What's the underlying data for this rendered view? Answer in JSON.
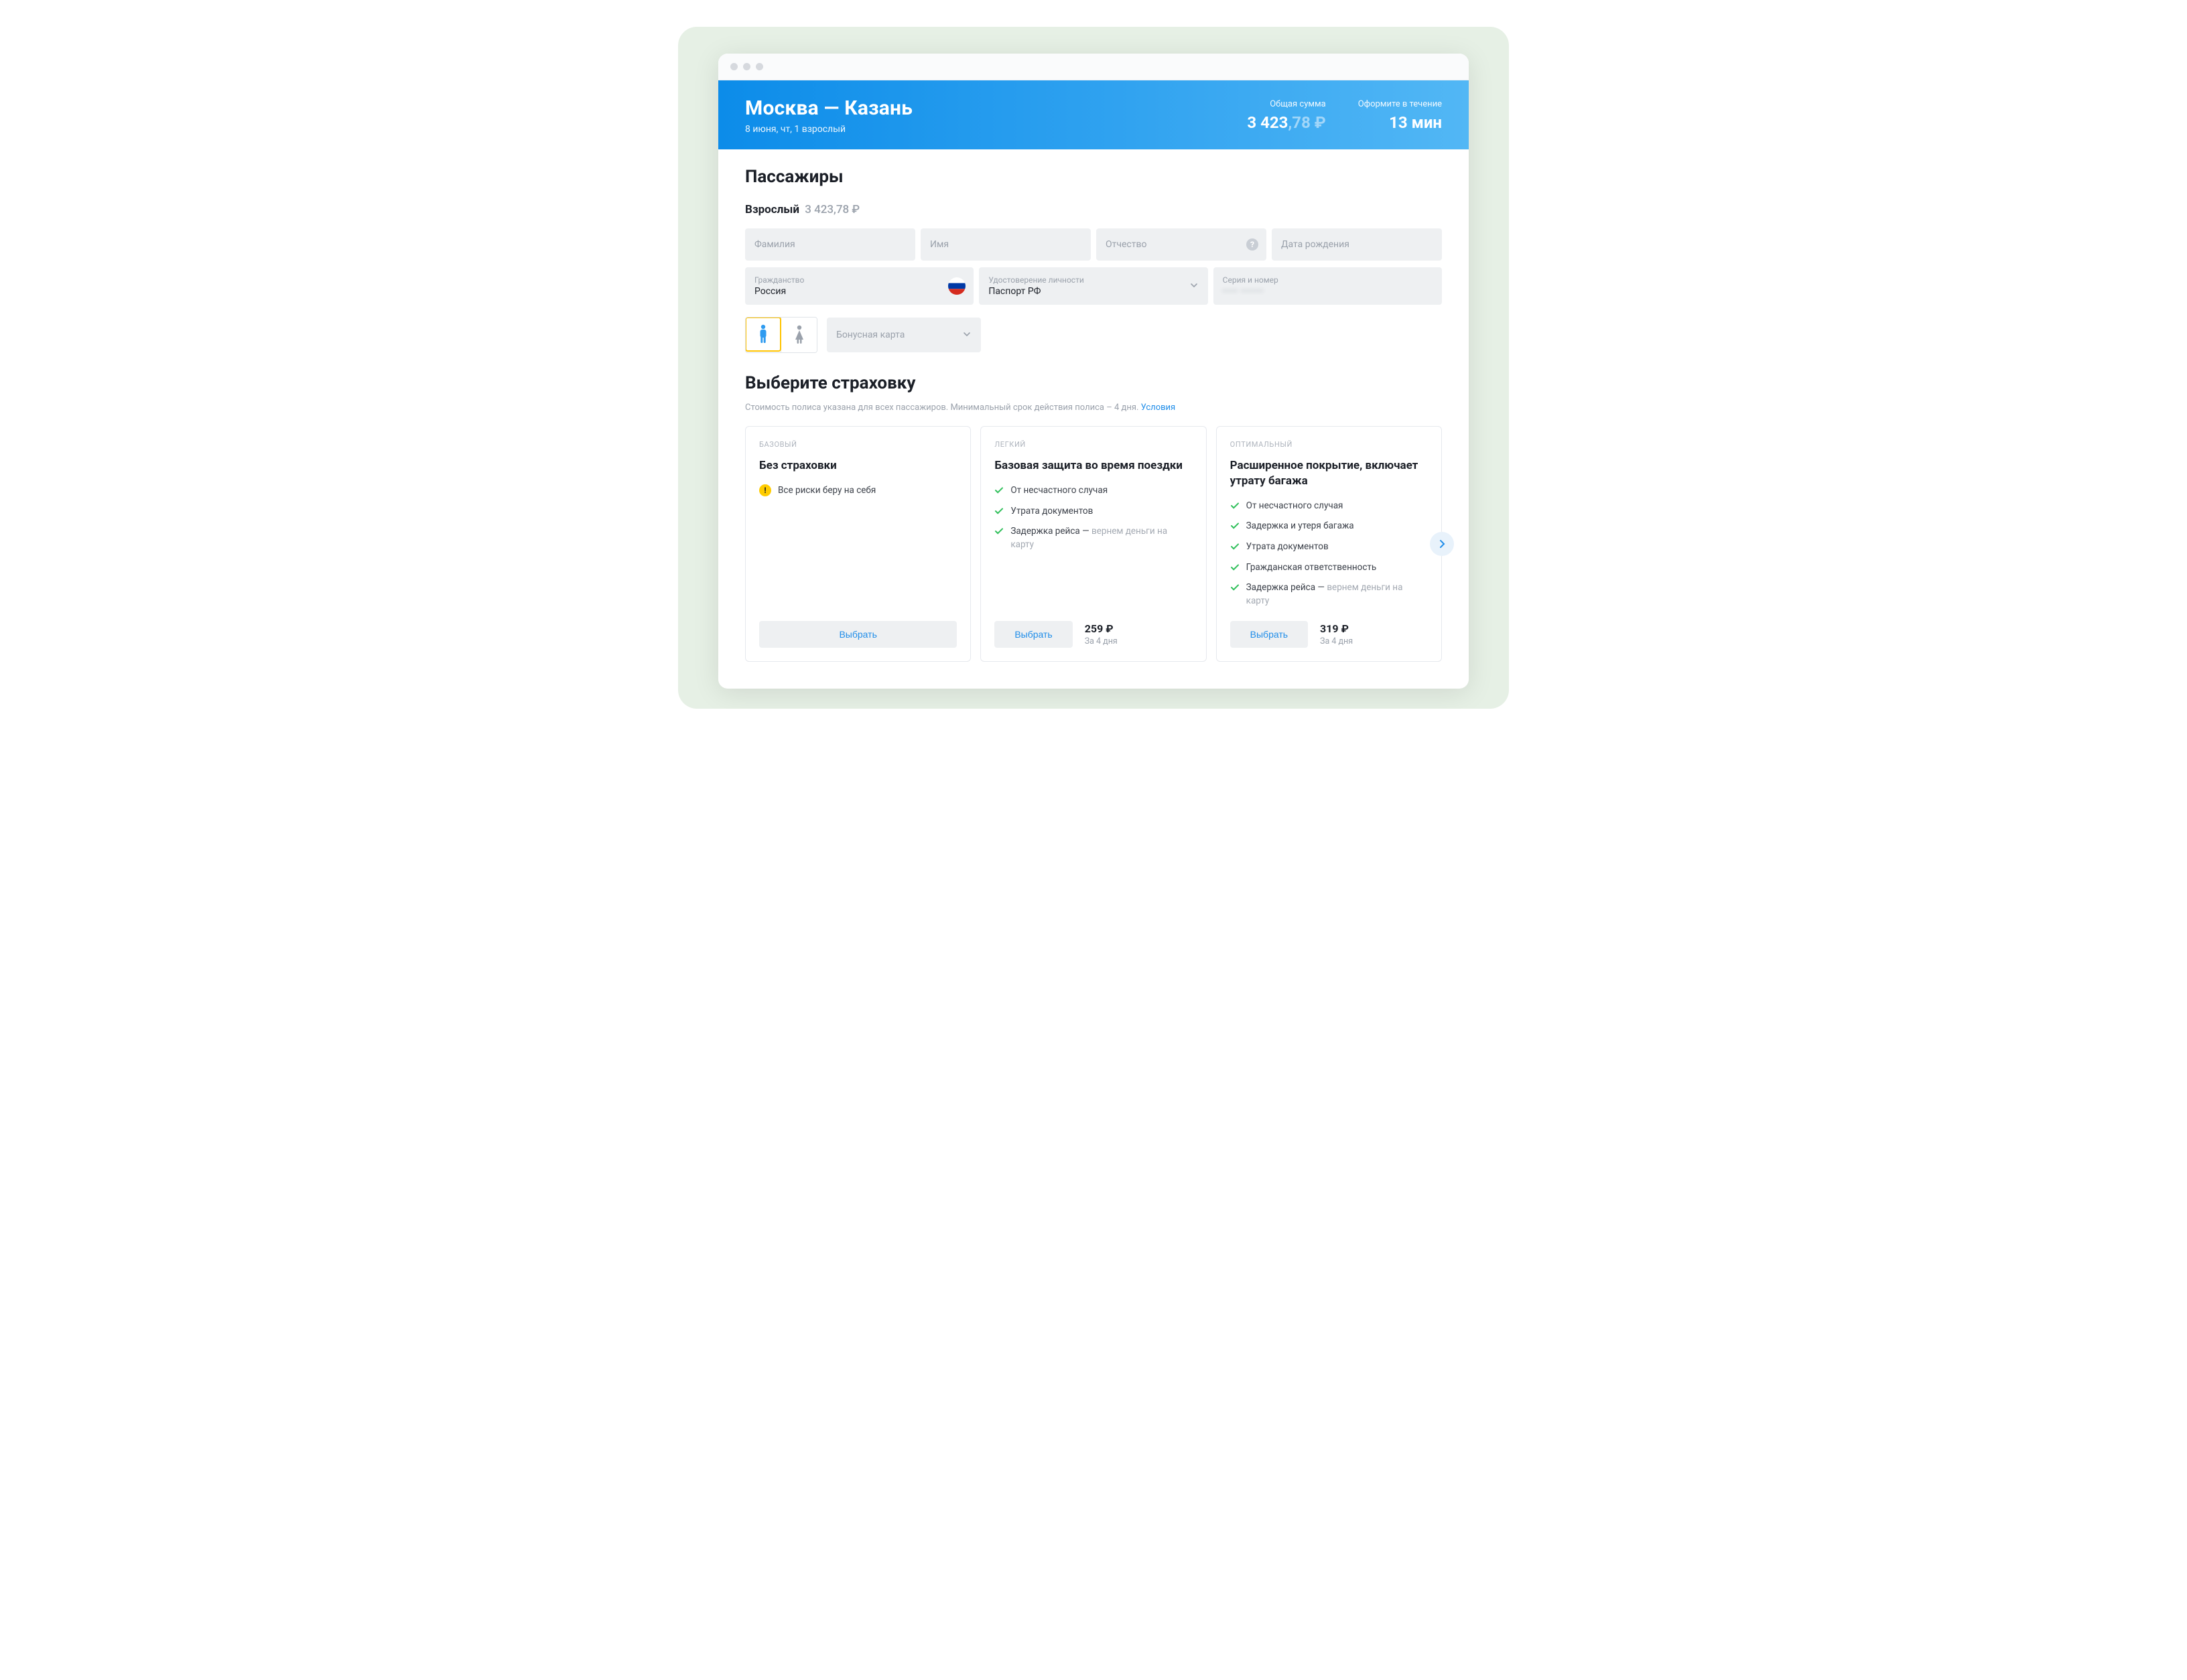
{
  "header": {
    "route": "Москва — Казань",
    "sub": "8 июня, чт, 1 взрослый",
    "total_label": "Общая сумма",
    "total_int": "3 423",
    "total_frac": ",78 ₽",
    "timer_label": "Оформите в течение",
    "timer_value": "13 мин"
  },
  "passengers": {
    "heading": "Пассажиры",
    "type_label": "Взрослый",
    "type_price": "3 423,78 ₽",
    "fields": {
      "surname_ph": "Фамилия",
      "name_ph": "Имя",
      "patronymic_ph": "Отчество",
      "dob_ph": "Дата рождения",
      "citizenship_label": "Гражданство",
      "citizenship_value": "Россия",
      "id_label": "Удостоверение личности",
      "id_value": "Паспорт РФ",
      "series_label": "Серия и номер",
      "series_value_masked": "•••• ••••••",
      "bonus_ph": "Бонусная карта"
    }
  },
  "insurance": {
    "heading": "Выберите страховку",
    "sub_text": "Стоимость полиса указана для всех пассажиров. Минимальный срок действия полиса – 4 дня. ",
    "sub_link": "Условия",
    "select_label": "Выбрать",
    "plans": [
      {
        "tier": "БАЗОВЫЙ",
        "title": "Без страховки",
        "warning": "Все риски беру на себя"
      },
      {
        "tier": "ЛЕГКИЙ",
        "title": "Базовая защита во время поездки",
        "features": [
          {
            "text": "От несчастного случая"
          },
          {
            "text": "Утрата документов"
          },
          {
            "text": "Задержка рейса — ",
            "muted": "вернем деньги на карту"
          }
        ],
        "price": "259 ₽",
        "duration": "За 4 дня"
      },
      {
        "tier": "ОПТИМАЛЬНЫЙ",
        "title": "Расширенное покрытие, включает утрату багажа",
        "features": [
          {
            "text": "От несчастного случая"
          },
          {
            "text": "Задержка и утеря багажа"
          },
          {
            "text": "Утрата документов"
          },
          {
            "text": "Гражданская ответственность"
          },
          {
            "text": "Задержка рейса — ",
            "muted": "вернем деньги на карту"
          }
        ],
        "price": "319 ₽",
        "duration": "За 4 дня"
      }
    ]
  }
}
